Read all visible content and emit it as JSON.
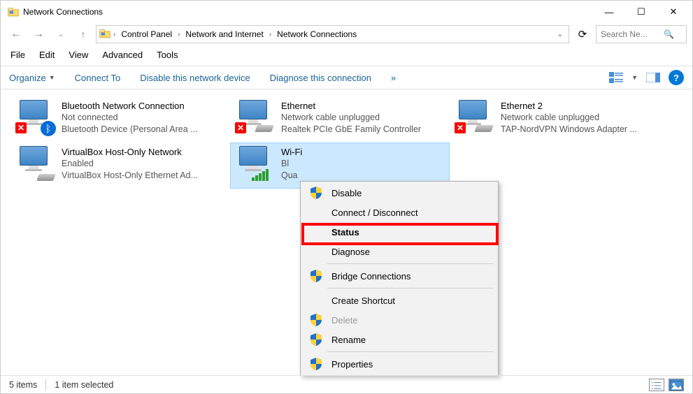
{
  "window": {
    "title": "Network Connections"
  },
  "breadcrumbs": {
    "b0": "Control Panel",
    "b1": "Network and Internet",
    "b2": "Network Connections"
  },
  "search": {
    "placeholder": "Search Ne..."
  },
  "menubar": {
    "file": "File",
    "edit": "Edit",
    "view": "View",
    "advanced": "Advanced",
    "tools": "Tools"
  },
  "toolbar": {
    "organize": "Organize",
    "connect_to": "Connect To",
    "disable": "Disable this network device",
    "diagnose": "Diagnose this connection",
    "more": "»"
  },
  "items": [
    {
      "name": "Bluetooth Network Connection",
      "status": "Not connected",
      "device": "Bluetooth Device (Personal Area ..."
    },
    {
      "name": "Ethernet",
      "status": "Network cable unplugged",
      "device": "Realtek PCIe GbE Family Controller"
    },
    {
      "name": "Ethernet 2",
      "status": "Network cable unplugged",
      "device": "TAP-NordVPN Windows Adapter ..."
    },
    {
      "name": "VirtualBox Host-Only Network",
      "status": "Enabled",
      "device": "VirtualBox Host-Only Ethernet Ad..."
    },
    {
      "name": "Wi-Fi",
      "status": "Bl",
      "device": "Qua"
    }
  ],
  "context_menu": {
    "disable": "Disable",
    "connect_disconnect": "Connect / Disconnect",
    "status": "Status",
    "diagnose": "Diagnose",
    "bridge": "Bridge Connections",
    "create_shortcut": "Create Shortcut",
    "delete": "Delete",
    "rename": "Rename",
    "properties": "Properties"
  },
  "statusbar": {
    "count": "5 items",
    "selected": "1 item selected"
  }
}
